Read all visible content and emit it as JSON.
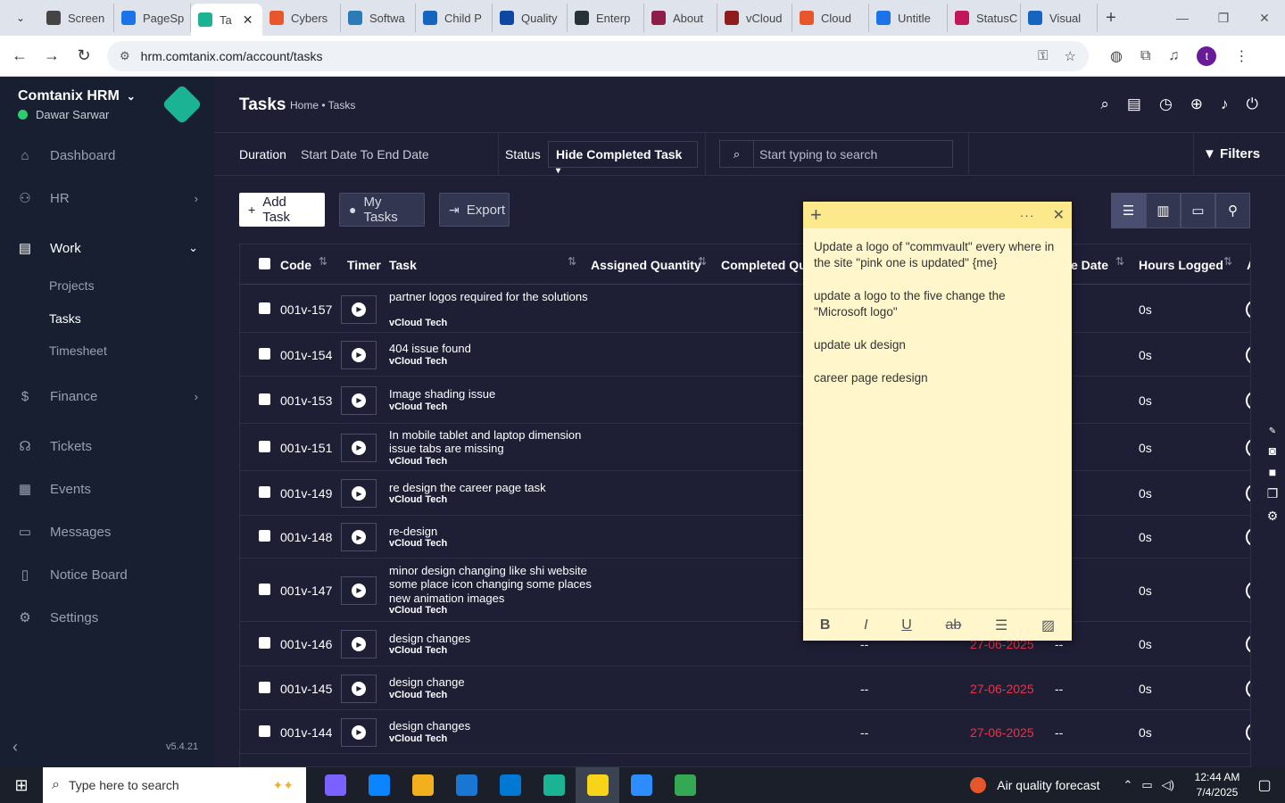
{
  "browser": {
    "tabs": [
      {
        "label": "Screen",
        "color": "#444444"
      },
      {
        "label": "PageSp",
        "color": "#1a73e8"
      },
      {
        "label": "Ta",
        "color": "#1ab394",
        "active": true
      },
      {
        "label": "Cybers",
        "color": "#e8572c"
      },
      {
        "label": "Softwa",
        "color": "#2b7bb9"
      },
      {
        "label": "Child P",
        "color": "#1565c0"
      },
      {
        "label": "Quality",
        "color": "#0d47a1"
      },
      {
        "label": "Enterp",
        "color": "#263238"
      },
      {
        "label": "About",
        "color": "#8e1d4a"
      },
      {
        "label": "vCloud",
        "color": "#8e1d1d"
      },
      {
        "label": "Cloud",
        "color": "#e8572c"
      },
      {
        "label": "Untitle",
        "color": "#1a73e8"
      },
      {
        "label": "StatusC",
        "color": "#c2185b"
      },
      {
        "label": "Visual",
        "color": "#1565c0"
      }
    ],
    "url": "hrm.comtanix.com/account/tasks",
    "profile_initial": "t"
  },
  "sidebar": {
    "brand": "Comtanix HRM",
    "user": "Dawar Sarwar",
    "menu": {
      "dashboard": "Dashboard",
      "hr": "HR",
      "work": "Work",
      "finance": "Finance",
      "tickets": "Tickets",
      "events": "Events",
      "messages": "Messages",
      "notice_board": "Notice Board",
      "settings": "Settings"
    },
    "work_sub": {
      "projects": "Projects",
      "tasks": "Tasks",
      "timesheet": "Timesheet"
    },
    "version": "v5.4.21"
  },
  "header": {
    "title": "Tasks",
    "breadcrumb": "Home • Tasks"
  },
  "filterbar": {
    "duration_label": "Duration",
    "duration_value": "Start Date To End Date",
    "status_label": "Status",
    "status_value": "Hide Completed Task",
    "search_placeholder": "Start typing to search",
    "filters_label": "Filters"
  },
  "actions": {
    "add_task": "Add Task",
    "my_tasks": "My Tasks",
    "export": "Export"
  },
  "table": {
    "headers": {
      "code": "Code",
      "timer": "Timer",
      "task": "Task",
      "assigned_qty": "Assigned Quantity",
      "completed_qty": "Completed Qua",
      "due_date": "e Date",
      "hours_logged": "Hours Logged",
      "extra": "A"
    },
    "rows": [
      {
        "code": "001v-157",
        "task": "partner logos required for the solutions",
        "project": "vCloud Tech",
        "hours": "0s"
      },
      {
        "code": "001v-154",
        "task": "404 issue found",
        "project": "vCloud Tech",
        "hours": "0s"
      },
      {
        "code": "001v-153",
        "task": "Image shading issue",
        "project": "vCloud Tech",
        "hours": "0s"
      },
      {
        "code": "001v-151",
        "task": "In mobile tablet and laptop dimension issue tabs are missing",
        "project": "vCloud Tech",
        "hours": "0s"
      },
      {
        "code": "001v-149",
        "task": "re design the career page task",
        "project": "vCloud Tech",
        "hours": "0s"
      },
      {
        "code": "001v-148",
        "task": "re-design",
        "project": "vCloud Tech",
        "hours": "0s"
      },
      {
        "code": "001v-147",
        "task": "minor design changing like shi website some place icon changing some places new animation images",
        "project": "vCloud Tech",
        "hours": "0s"
      },
      {
        "code": "001v-146",
        "task": "design changes",
        "project": "vCloud Tech",
        "start": "--",
        "due": "27-06-2025",
        "extra": "--",
        "hours": "0s"
      },
      {
        "code": "001v-145",
        "task": "design change",
        "project": "vCloud Tech",
        "start": "--",
        "due": "27-06-2025",
        "extra": "--",
        "hours": "0s"
      },
      {
        "code": "001v-144",
        "task": "design changes",
        "project": "vCloud Tech",
        "start": "--",
        "due": "27-06-2025",
        "extra": "--",
        "hours": "0s"
      }
    ]
  },
  "sticky_note": {
    "lines": [
      "Update a logo of \"commvault\" every where in the site \"pink one is updated\" {me}",
      "update a logo to the five change the \"Microsoft logo\"",
      "update uk design",
      "career page redesign"
    ]
  },
  "taskbar": {
    "search_placeholder": "Type here to search",
    "weather": "Air quality forecast",
    "time": "12:44 AM",
    "date": "7/4/2025",
    "apps": [
      "#7b61ff",
      "#0a84ff",
      "#f2b01e",
      "#1976d2",
      "#0078d4",
      "#1ab394",
      "#f7d417",
      "#2d8cff",
      "#34a853"
    ]
  }
}
